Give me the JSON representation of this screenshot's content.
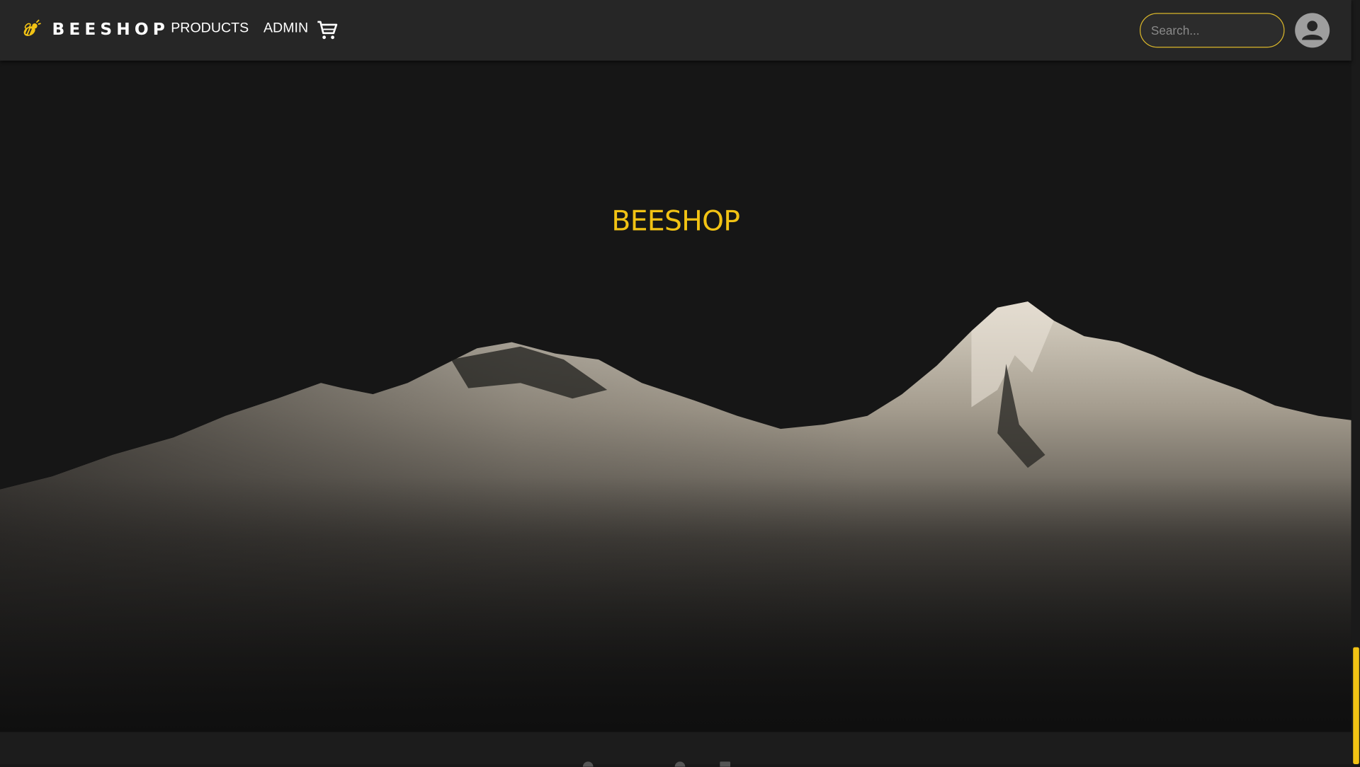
{
  "navbar": {
    "brand": "BEESHOP",
    "brand_icon": "bee-icon",
    "links": [
      {
        "label": "PRODUCTS"
      },
      {
        "label": "ADMIN"
      }
    ],
    "cart_icon": "shopping-cart-icon",
    "search_placeholder": "Search...",
    "avatar_icon": "user-account-icon"
  },
  "hero": {
    "title": "BEESHOP",
    "background": "snow-capped-mountains-image"
  },
  "colors": {
    "accent": "#f2c314",
    "navbar_bg": "#262626",
    "page_bg": "#181818"
  }
}
